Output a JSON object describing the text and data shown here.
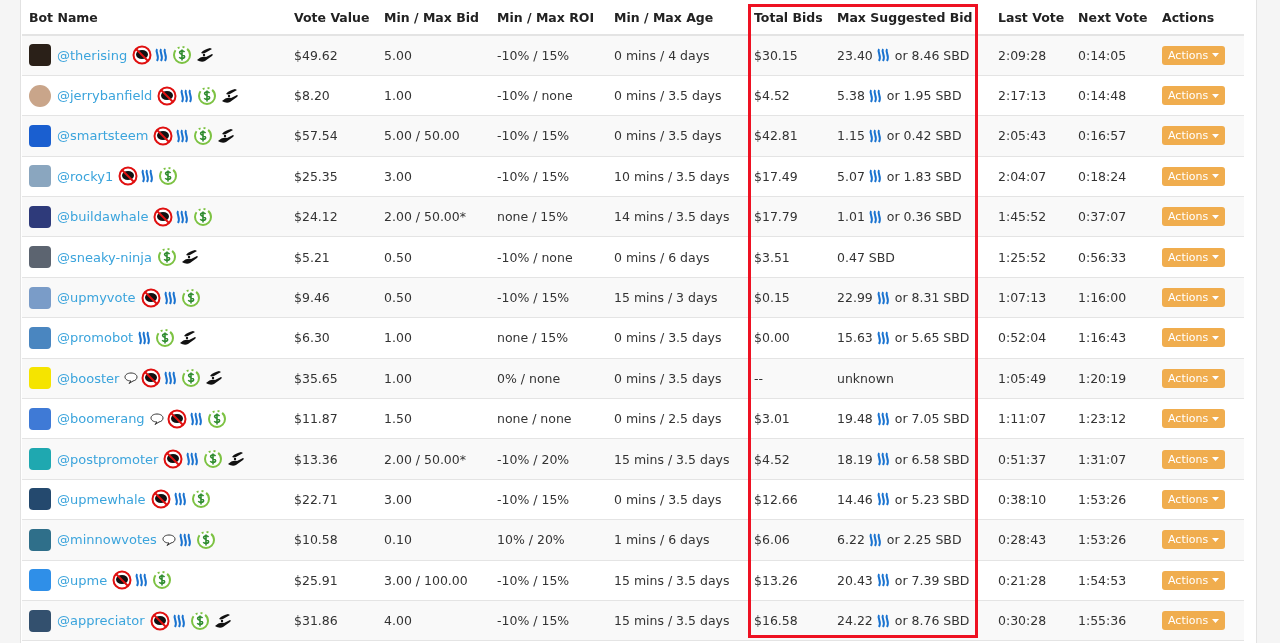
{
  "columns": [
    "Bot Name",
    "Vote Value",
    "Min / Max Bid",
    "Min / Max ROI",
    "Min / Max Age",
    "Total Bids",
    "Max Suggested Bid",
    "Last Vote",
    "Next Vote",
    "Actions"
  ],
  "rows": [
    {
      "name": "@therising",
      "color": "#2a2018",
      "comments": false,
      "no_comments": true,
      "steem": true,
      "refund": true,
      "hand": true,
      "vote_value": "$49.62",
      "bid": "5.00",
      "roi": "-10% / 15%",
      "age": "0 mins / 4 days",
      "total": "$30.15",
      "max_bid": {
        "kind": "pair",
        "steem": "23.40",
        "sbd": "or 8.46 SBD"
      },
      "last": "2:09:28",
      "next": "0:14:05",
      "action": "Actions"
    },
    {
      "name": "@jerrybanfield",
      "color": "#c9a58a",
      "comments": false,
      "no_comments": true,
      "steem": true,
      "refund": true,
      "hand": true,
      "vote_value": "$8.20",
      "bid": "1.00",
      "roi": "-10% / none",
      "age": "0 mins / 3.5 days",
      "total": "$4.52",
      "max_bid": {
        "kind": "pair",
        "steem": "5.38",
        "sbd": "or 1.95 SBD"
      },
      "last": "2:17:13",
      "next": "0:14:48",
      "action": "Actions"
    },
    {
      "name": "@smartsteem",
      "color": "#1a5fd0",
      "comments": false,
      "no_comments": true,
      "steem": true,
      "refund": true,
      "hand": true,
      "vote_value": "$57.54",
      "bid": "5.00 / 50.00",
      "roi": "-10% / 15%",
      "age": "0 mins / 3.5 days",
      "total": "$42.81",
      "max_bid": {
        "kind": "pair",
        "steem": "1.15",
        "sbd": "or 0.42 SBD"
      },
      "last": "2:05:43",
      "next": "0:16:57",
      "action": "Actions"
    },
    {
      "name": "@rocky1",
      "color": "#8aa6bf",
      "comments": false,
      "no_comments": true,
      "steem": true,
      "refund": true,
      "hand": false,
      "vote_value": "$25.35",
      "bid": "3.00",
      "roi": "-10% / 15%",
      "age": "10 mins / 3.5 days",
      "total": "$17.49",
      "max_bid": {
        "kind": "pair",
        "steem": "5.07",
        "sbd": "or 1.83 SBD"
      },
      "last": "2:04:07",
      "next": "0:18:24",
      "action": "Actions"
    },
    {
      "name": "@buildawhale",
      "color": "#2e3a7a",
      "comments": false,
      "no_comments": true,
      "steem": true,
      "refund": true,
      "hand": false,
      "vote_value": "$24.12",
      "bid": "2.00 / 50.00*",
      "roi": "none / 15%",
      "age": "14 mins / 3.5 days",
      "total": "$17.79",
      "max_bid": {
        "kind": "pair",
        "steem": "1.01",
        "sbd": "or 0.36 SBD"
      },
      "last": "1:45:52",
      "next": "0:37:07",
      "action": "Actions"
    },
    {
      "name": "@sneaky-ninja",
      "color": "#5c6470",
      "comments": false,
      "no_comments": false,
      "steem": false,
      "refund": true,
      "hand": true,
      "vote_value": "$5.21",
      "bid": "0.50",
      "roi": "-10% / none",
      "age": "0 mins / 6 days",
      "total": "$3.51",
      "max_bid": {
        "kind": "text",
        "text": "0.47 SBD"
      },
      "last": "1:25:52",
      "next": "0:56:33",
      "action": "Actions"
    },
    {
      "name": "@upmyvote",
      "color": "#7a9cc8",
      "comments": false,
      "no_comments": true,
      "steem": true,
      "refund": true,
      "hand": false,
      "vote_value": "$9.46",
      "bid": "0.50",
      "roi": "-10% / 15%",
      "age": "15 mins / 3 days",
      "total": "$0.15",
      "max_bid": {
        "kind": "pair",
        "steem": "22.99",
        "sbd": "or 8.31 SBD"
      },
      "last": "1:07:13",
      "next": "1:16:00",
      "action": "Actions"
    },
    {
      "name": "@promobot",
      "color": "#4a86c0",
      "comments": false,
      "no_comments": false,
      "steem": true,
      "refund": true,
      "hand": true,
      "vote_value": "$6.30",
      "bid": "1.00",
      "roi": "none / 15%",
      "age": "0 mins / 3.5 days",
      "total": "$0.00",
      "max_bid": {
        "kind": "pair",
        "steem": "15.63",
        "sbd": "or 5.65 SBD"
      },
      "last": "0:52:04",
      "next": "1:16:43",
      "action": "Actions"
    },
    {
      "name": "@booster",
      "color": "#f5e400",
      "comments": true,
      "no_comments": true,
      "steem": true,
      "refund": true,
      "hand": true,
      "vote_value": "$35.65",
      "bid": "1.00",
      "roi": "0% / none",
      "age": "0 mins / 3.5 days",
      "total": "--",
      "max_bid": {
        "kind": "text",
        "text": "unknown"
      },
      "last": "1:05:49",
      "next": "1:20:19",
      "action": "Actions"
    },
    {
      "name": "@boomerang",
      "color": "#3f7ad6",
      "comments": true,
      "no_comments": true,
      "steem": true,
      "refund": true,
      "hand": false,
      "vote_value": "$11.87",
      "bid": "1.50",
      "roi": "none / none",
      "age": "0 mins / 2.5 days",
      "total": "$3.01",
      "max_bid": {
        "kind": "pair",
        "steem": "19.48",
        "sbd": "or 7.05 SBD"
      },
      "last": "1:11:07",
      "next": "1:23:12",
      "action": "Actions"
    },
    {
      "name": "@postpromoter",
      "color": "#1fa8b0",
      "comments": false,
      "no_comments": true,
      "steem": true,
      "refund": true,
      "hand": true,
      "vote_value": "$13.36",
      "bid": "2.00 / 50.00*",
      "roi": "-10% / 20%",
      "age": "15 mins / 3.5 days",
      "total": "$4.52",
      "max_bid": {
        "kind": "pair",
        "steem": "18.19",
        "sbd": "or 6.58 SBD"
      },
      "last": "0:51:37",
      "next": "1:31:07",
      "action": "Actions"
    },
    {
      "name": "@upmewhale",
      "color": "#24496e",
      "comments": false,
      "no_comments": true,
      "steem": true,
      "refund": true,
      "hand": false,
      "vote_value": "$22.71",
      "bid": "3.00",
      "roi": "-10% / 15%",
      "age": "0 mins / 3.5 days",
      "total": "$12.66",
      "max_bid": {
        "kind": "pair",
        "steem": "14.46",
        "sbd": "or 5.23 SBD"
      },
      "last": "0:38:10",
      "next": "1:53:26",
      "action": "Actions"
    },
    {
      "name": "@minnowvotes",
      "color": "#2f6f8a",
      "comments": true,
      "no_comments": false,
      "steem": true,
      "refund": true,
      "hand": false,
      "vote_value": "$10.58",
      "bid": "0.10",
      "roi": "10% / 20%",
      "age": "1 mins / 6 days",
      "total": "$6.06",
      "max_bid": {
        "kind": "pair",
        "steem": "6.22",
        "sbd": "or 2.25 SBD"
      },
      "last": "0:28:43",
      "next": "1:53:26",
      "action": "Actions"
    },
    {
      "name": "@upme",
      "color": "#2f8fe8",
      "comments": false,
      "no_comments": true,
      "steem": true,
      "refund": true,
      "hand": false,
      "vote_value": "$25.91",
      "bid": "3.00 / 100.00",
      "roi": "-10% / 15%",
      "age": "15 mins / 3.5 days",
      "total": "$13.26",
      "max_bid": {
        "kind": "pair",
        "steem": "20.43",
        "sbd": "or 7.39 SBD"
      },
      "last": "0:21:28",
      "next": "1:54:53",
      "action": "Actions"
    },
    {
      "name": "@appreciator",
      "color": "#33506e",
      "comments": false,
      "no_comments": true,
      "steem": true,
      "refund": true,
      "hand": true,
      "vote_value": "$31.86",
      "bid": "4.00",
      "roi": "-10% / 15%",
      "age": "15 mins / 3.5 days",
      "total": "$16.58",
      "max_bid": {
        "kind": "pair",
        "steem": "24.22",
        "sbd": "or 8.76 SBD"
      },
      "last": "0:30:28",
      "next": "1:55:36",
      "action": "Actions"
    }
  ]
}
